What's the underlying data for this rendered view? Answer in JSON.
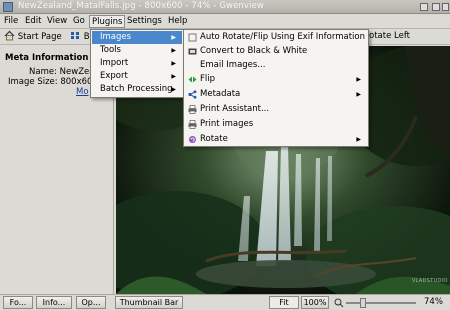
{
  "window": {
    "title": "NewZealand_MatalFalls.jpg - 800x600 - 74% - Gwenview"
  },
  "menubar": {
    "items": [
      "File",
      "Edit",
      "View",
      "Go",
      "Plugins",
      "Settings",
      "Help"
    ],
    "active": "Plugins"
  },
  "toolbar": {
    "start_page": "Start Page",
    "truncated_label": "B",
    "rotate_left": "otate Left"
  },
  "sidebar": {
    "title": "Meta Information",
    "name_label": "Name:",
    "name_value": "NewZea",
    "size_label": "Image Size:",
    "size_value": "800x60",
    "more_link": "Mo"
  },
  "image": {
    "watermark": "VLADSTUDIO"
  },
  "statusbar": {
    "btn1": "Fo...",
    "btn2": "Info...",
    "btn3": "Op...",
    "thumbnail_bar": "Thumbnail Bar",
    "fit": "Fit",
    "zoom_100": "100%",
    "zoom_percent": "74%",
    "zoom_level": 0.74
  },
  "plugins_menu": {
    "items": [
      "Images",
      "Tools",
      "Import",
      "Export",
      "Batch Processing"
    ],
    "selected": "Images"
  },
  "images_submenu": {
    "items": [
      {
        "label": "Auto Rotate/Flip Using Exif Information",
        "icon": "auto-rotate-icon",
        "arrow": false
      },
      {
        "label": "Convert to Black & White",
        "icon": "black-white-icon",
        "arrow": false
      },
      {
        "label": "Email Images...",
        "icon": "",
        "arrow": false
      },
      {
        "label": "Flip",
        "icon": "flip-icon",
        "arrow": true
      },
      {
        "label": "Metadata",
        "icon": "metadata-icon",
        "arrow": true
      },
      {
        "label": "Print Assistant...",
        "icon": "printer-icon",
        "arrow": false
      },
      {
        "label": "Print images",
        "icon": "printer-icon",
        "arrow": false
      },
      {
        "label": "Rotate",
        "icon": "rotate-icon",
        "arrow": true
      }
    ]
  },
  "colors": {
    "selection": "#4a87cc",
    "link": "#1a3e9a",
    "window_bg": "#dcdad5"
  }
}
